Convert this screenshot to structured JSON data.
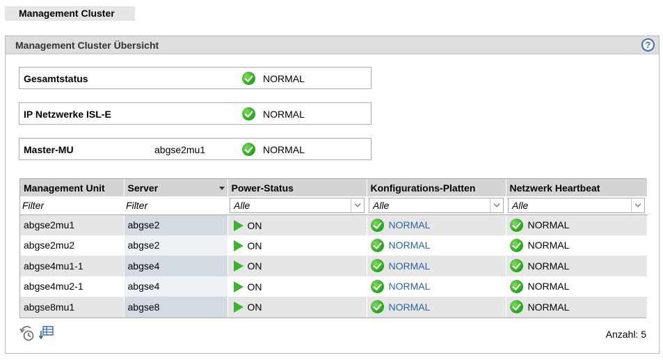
{
  "page": {
    "tab_title": "Management Cluster",
    "panel_title": "Management Cluster Übersicht",
    "help_symbol": "?"
  },
  "status": [
    {
      "label": "Gesamtstatus",
      "value": "",
      "status": "NORMAL"
    },
    {
      "label": "IP Netzwerke ISL-E",
      "value": "",
      "status": "NORMAL"
    },
    {
      "label": "Master-MU",
      "value": "abgse2mu1",
      "status": "NORMAL"
    }
  ],
  "table": {
    "columns": [
      "Management Unit",
      "Server",
      "Power-Status",
      "Konfigurations-Platten",
      "Netzwerk Heartbeat"
    ],
    "filters": {
      "management_unit": "Filter",
      "server": "Filter",
      "power_status": "Alle",
      "config_disks": "Alle",
      "heartbeat": "Alle"
    },
    "rows": [
      {
        "mu": "abgse2mu1",
        "server": "abgse2",
        "power": "ON",
        "disks": "NORMAL",
        "heartbeat": "NORMAL"
      },
      {
        "mu": "abgse2mu2",
        "server": "abgse2",
        "power": "ON",
        "disks": "NORMAL",
        "heartbeat": "NORMAL"
      },
      {
        "mu": "abgse4mu1-1",
        "server": "abgse4",
        "power": "ON",
        "disks": "NORMAL",
        "heartbeat": "NORMAL"
      },
      {
        "mu": "abgse4mu2-1",
        "server": "abgse4",
        "power": "ON",
        "disks": "NORMAL",
        "heartbeat": "NORMAL"
      },
      {
        "mu": "abgse8mu1",
        "server": "abgse8",
        "power": "ON",
        "disks": "NORMAL",
        "heartbeat": "NORMAL"
      }
    ]
  },
  "footer": {
    "count_label": "Anzahl: 5"
  },
  "icons": {
    "ok": "check-circle-icon",
    "power_on": "play-icon",
    "refresh": "refresh-clock-icon",
    "export": "table-export-icon",
    "help": "help-icon"
  },
  "colors": {
    "ok_green": "#2fa826",
    "link_blue": "#2a62a6",
    "header_bg": "#d4d4d4",
    "help_blue": "#3a6fb5"
  }
}
